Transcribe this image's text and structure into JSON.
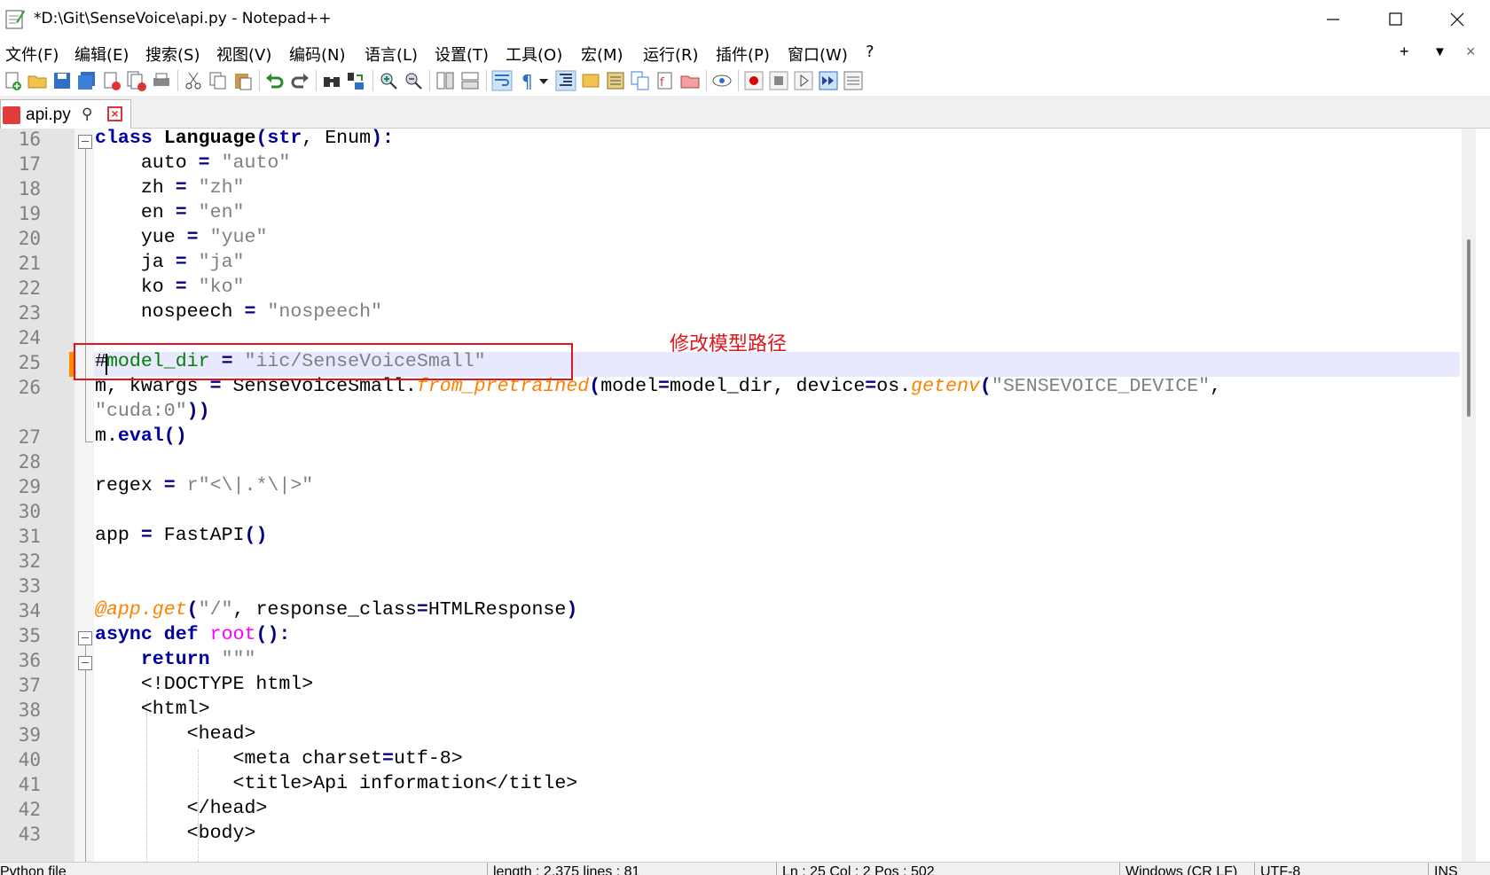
{
  "window": {
    "title": "*D:\\Git\\SenseVoice\\api.py - Notepad++",
    "min_icon": "minimize-icon",
    "max_icon": "maximize-icon",
    "close_icon": "close-icon"
  },
  "menu": {
    "items": [
      "文件(F)",
      "编辑(E)",
      "搜索(S)",
      "视图(V)",
      "编码(N)",
      "语言(L)",
      "设置(T)",
      "工具(O)",
      "宏(M)",
      "运行(R)",
      "插件(P)",
      "窗口(W)",
      "?"
    ],
    "right": [
      "+",
      "▼",
      "×"
    ]
  },
  "tab": {
    "label": "api.py",
    "pin_glyph": "⚲",
    "close_glyph": "×"
  },
  "editor": {
    "line_numbers": [
      "16",
      "17",
      "18",
      "19",
      "20",
      "21",
      "22",
      "23",
      "24",
      "25",
      "26",
      "",
      "27",
      "28",
      "29",
      "30",
      "31",
      "32",
      "33",
      "34",
      "35",
      "36",
      "37",
      "38",
      "39",
      "40",
      "41",
      "42",
      "43"
    ],
    "lines": [
      "class Language(str, Enum):",
      "    auto = \"auto\"",
      "    zh = \"zh\"",
      "    en = \"en\"",
      "    yue = \"yue\"",
      "    ja = \"ja\"",
      "    ko = \"ko\"",
      "    nospeech = \"nospeech\"",
      "",
      "#model_dir = \"iic/SenseVoiceSmall\"",
      "m, kwargs = SenseVoiceSmall.from_pretrained(model=model_dir, device=os.getenv(\"SENSEVOICE_DEVICE\",",
      "\"cuda:0\"))",
      "m.eval()",
      "",
      "regex = r\"<\\|.*\\|>\"",
      "",
      "app = FastAPI()",
      "",
      "",
      "@app.get(\"/\", response_class=HTMLResponse)",
      "async def root():",
      "    return \"\"\"",
      "    <!DOCTYPE html>",
      "    <html>",
      "        <head>",
      "            <meta charset=utf-8>",
      "            <title>Api information</title>",
      "        </head>",
      "        <body>"
    ]
  },
  "annotation": {
    "text": "修改模型路径",
    "color": "#e0161e"
  },
  "status": {
    "type": "Python file",
    "length": "length : 2,375    lines : 81",
    "position": "Ln : 25    Col : 2    Pos : 502",
    "eol": "Windows (CR LF)",
    "encoding": "UTF-8",
    "mode": "INS"
  }
}
